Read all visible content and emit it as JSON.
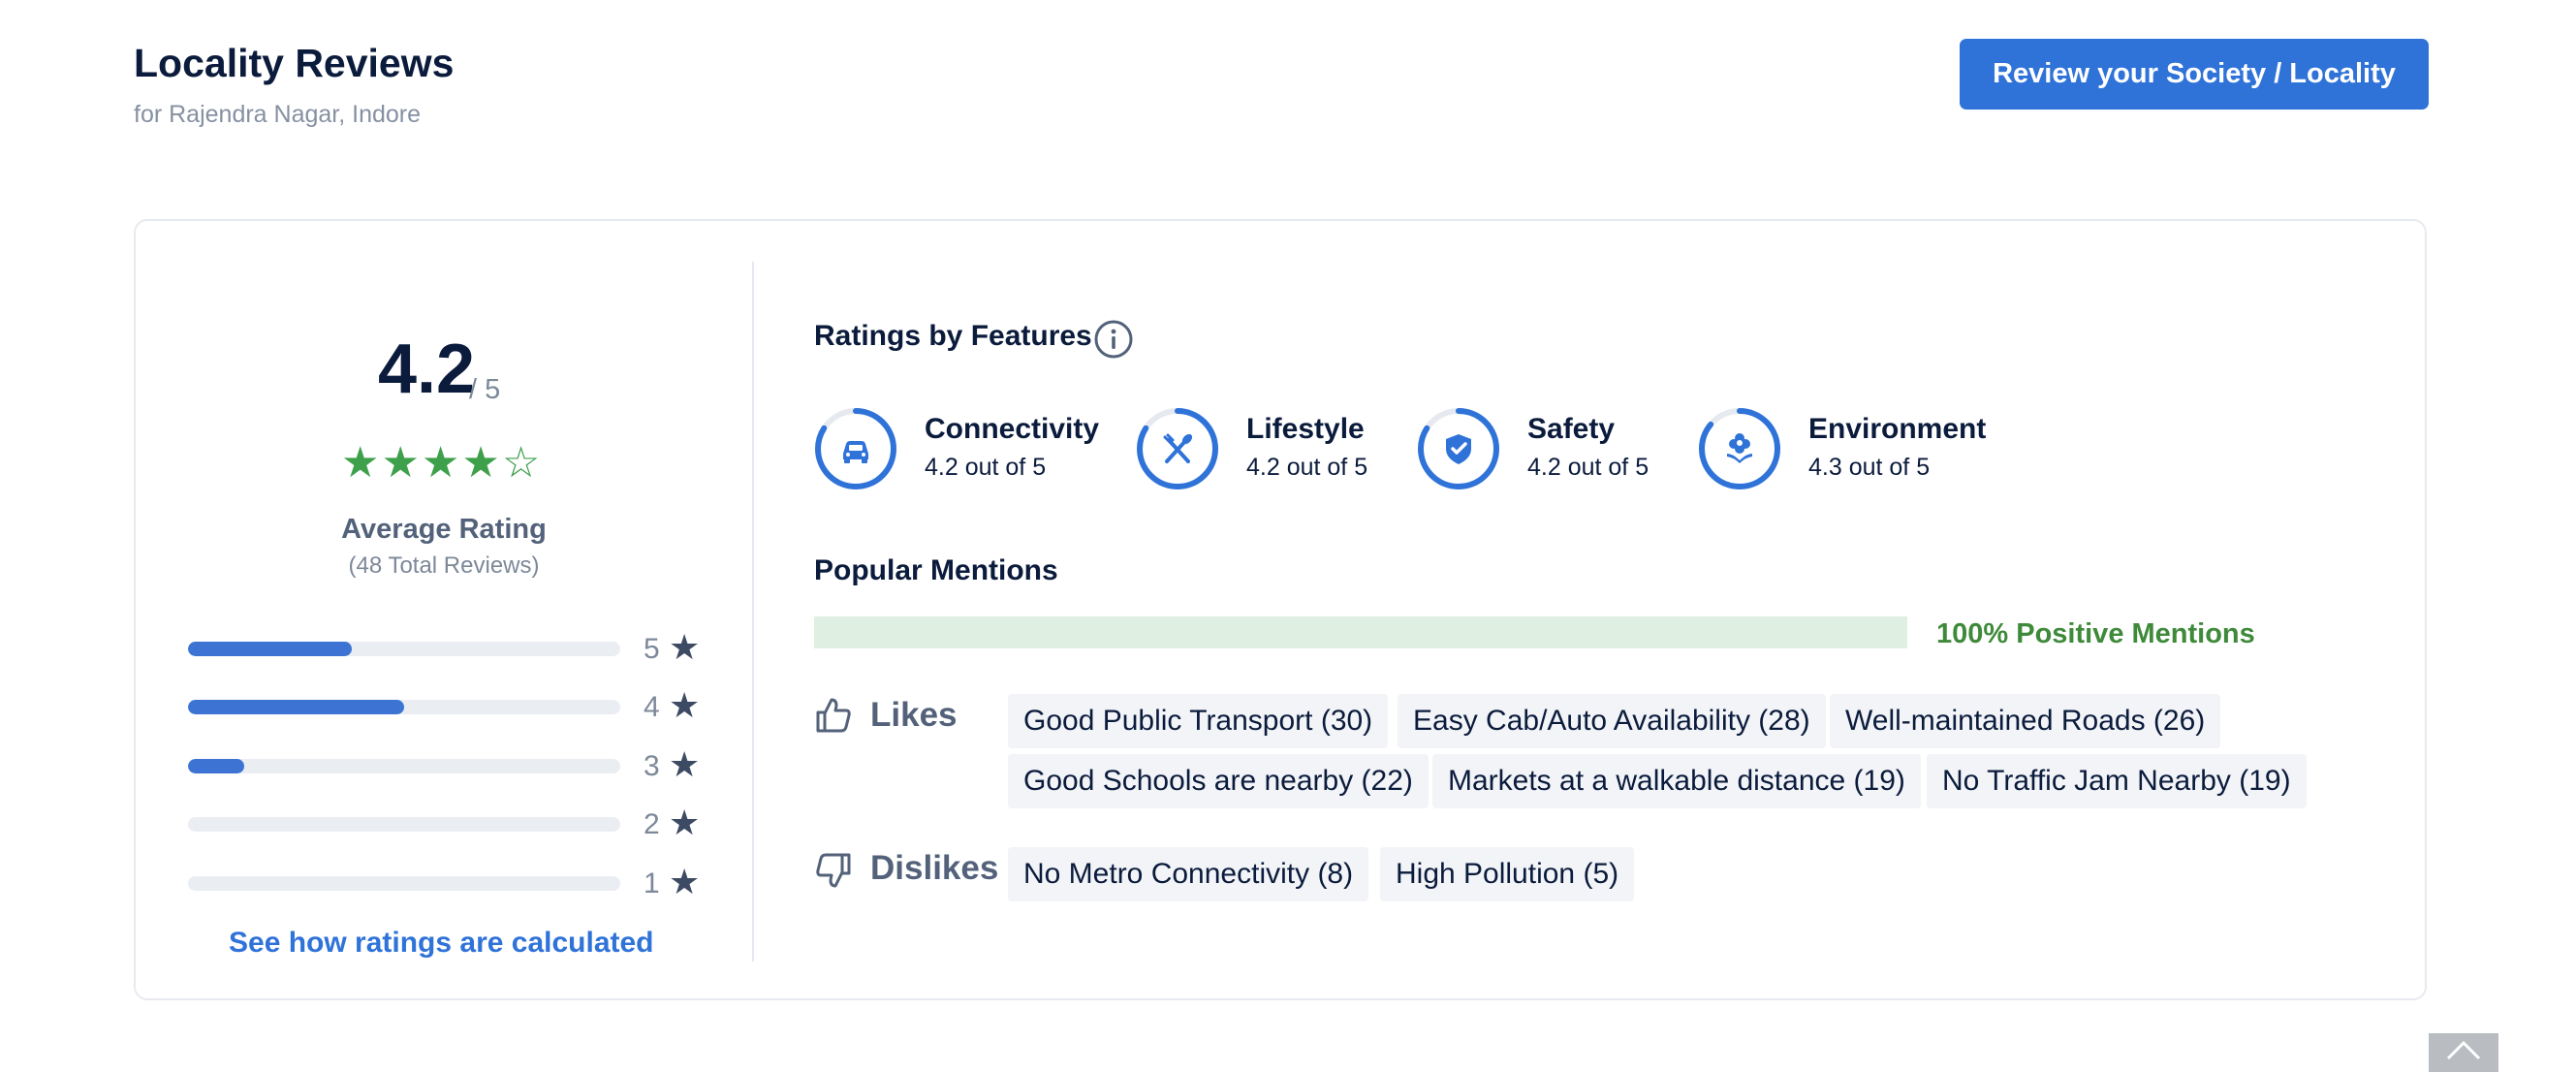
{
  "header": {
    "title": "Locality Reviews",
    "subtitle": "for Rajendra Nagar, Indore",
    "review_button": "Review your Society / Locality"
  },
  "summary": {
    "rating": "4.2",
    "rating_max": "/ 5",
    "stars": [
      "★",
      "★",
      "★",
      "★",
      "☆"
    ],
    "stars_value": 4.2,
    "label": "Average Rating",
    "total_reviews": "(48 Total Reviews)",
    "distribution": [
      {
        "stars": "5",
        "fraction": 0.38
      },
      {
        "stars": "4",
        "fraction": 0.5
      },
      {
        "stars": "3",
        "fraction": 0.13
      },
      {
        "stars": "2",
        "fraction": 0.0
      },
      {
        "stars": "1",
        "fraction": 0.0
      }
    ],
    "star_glyph": "★",
    "calc_link": "See how ratings are calculated"
  },
  "features": {
    "title": "Ratings by Features",
    "info_icon": "info-icon",
    "items": [
      {
        "name": "Connectivity",
        "value": "4.2 out of 5",
        "score": 4.2,
        "icon": "car-icon"
      },
      {
        "name": "Lifestyle",
        "value": "4.2 out of 5",
        "score": 4.2,
        "icon": "fork-knife-icon"
      },
      {
        "name": "Safety",
        "value": "4.2 out of 5",
        "score": 4.2,
        "icon": "shield-icon"
      },
      {
        "name": "Environment",
        "value": "4.3 out of 5",
        "score": 4.3,
        "icon": "flower-icon"
      }
    ]
  },
  "mentions": {
    "title": "Popular Mentions",
    "positive_percent": 100,
    "positive_text": "100% Positive Mentions",
    "likes_label": "Likes",
    "likes": [
      "Good Public Transport (30)",
      "Easy Cab/Auto Availability (28)",
      "Well-maintained Roads (26)",
      "Good Schools are nearby (22)",
      "Markets at a walkable distance (19)",
      "No Traffic Jam Nearby (19)"
    ],
    "dislikes_label": "Dislikes",
    "dislikes": [
      "No Metro Connectivity (8)",
      "High Pollution (5)"
    ]
  },
  "colors": {
    "accent": "#2f73d9",
    "star_green": "#3fa04b",
    "positive_green": "#3f8a3a",
    "bar_blue": "#3d74d4"
  }
}
